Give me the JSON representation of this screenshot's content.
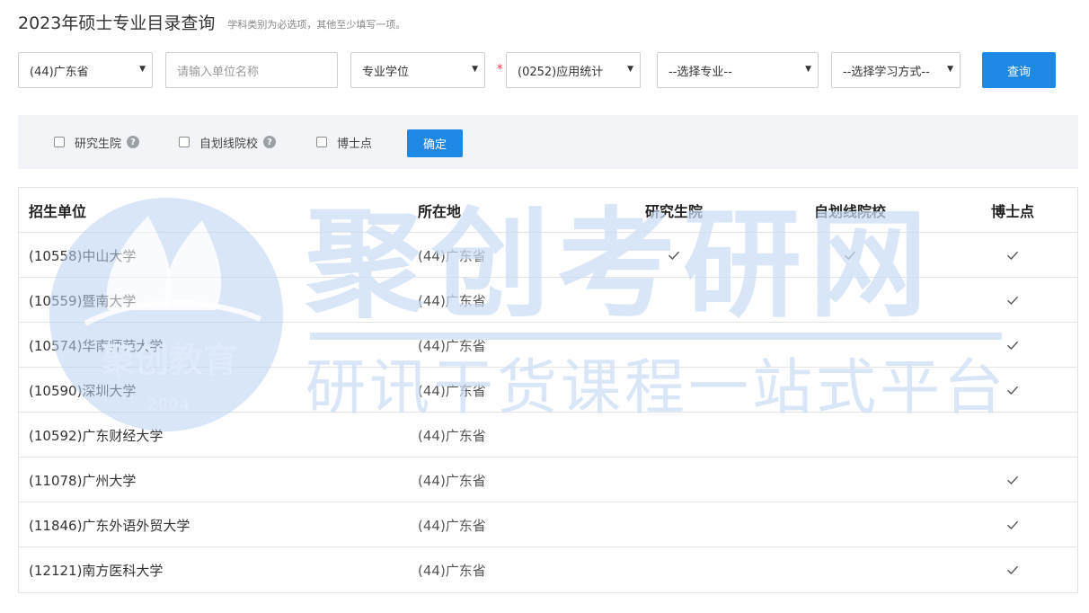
{
  "header": {
    "title": "2023年硕士专业目录查询",
    "note": "学科类别为必选项，其他至少填写一项。"
  },
  "filters": {
    "province": "(44)广东省",
    "unit_placeholder": "请输入单位名称",
    "degree_type": "专业学位",
    "required_mark": "*",
    "subject": "(0252)应用统计",
    "major": "--选择专业--",
    "study_mode": "--选择学习方式--",
    "query_label": "查询"
  },
  "options": {
    "graduate_school": "研究生院",
    "self_line": "自划线院校",
    "phd": "博士点",
    "help_glyph": "?",
    "confirm_label": "确定"
  },
  "table": {
    "headers": {
      "name": "招生单位",
      "location": "所在地",
      "graduate_school": "研究生院",
      "self_line": "自划线院校",
      "phd": "博士点"
    },
    "rows": [
      {
        "name": "(10558)中山大学",
        "location": "(44)广东省",
        "graduate_school": true,
        "self_line": true,
        "phd": true
      },
      {
        "name": "(10559)暨南大学",
        "location": "(44)广东省",
        "graduate_school": false,
        "self_line": false,
        "phd": true
      },
      {
        "name": "(10574)华南师范大学",
        "location": "(44)广东省",
        "graduate_school": false,
        "self_line": false,
        "phd": true
      },
      {
        "name": "(10590)深圳大学",
        "location": "(44)广东省",
        "graduate_school": false,
        "self_line": false,
        "phd": true
      },
      {
        "name": "(10592)广东财经大学",
        "location": "(44)广东省",
        "graduate_school": false,
        "self_line": false,
        "phd": false
      },
      {
        "name": "(11078)广州大学",
        "location": "(44)广东省",
        "graduate_school": false,
        "self_line": false,
        "phd": true
      },
      {
        "name": "(11846)广东外语外贸大学",
        "location": "(44)广东省",
        "graduate_school": false,
        "self_line": false,
        "phd": true
      },
      {
        "name": "(12121)南方医科大学",
        "location": "(44)广东省",
        "graduate_school": false,
        "self_line": false,
        "phd": true
      }
    ]
  },
  "watermark": {
    "brand": "聚创考研网",
    "slogan": "研讯干货课程一站式平台",
    "logo_text": "聚创教育",
    "logo_year": "2004"
  },
  "colors": {
    "accent": "#1e88e5",
    "required": "#e53935",
    "watermark": "#c9dcf5"
  },
  "icons": {
    "dropdown": "caret-down-icon",
    "help": "question-circle-icon",
    "check": "check-icon"
  }
}
